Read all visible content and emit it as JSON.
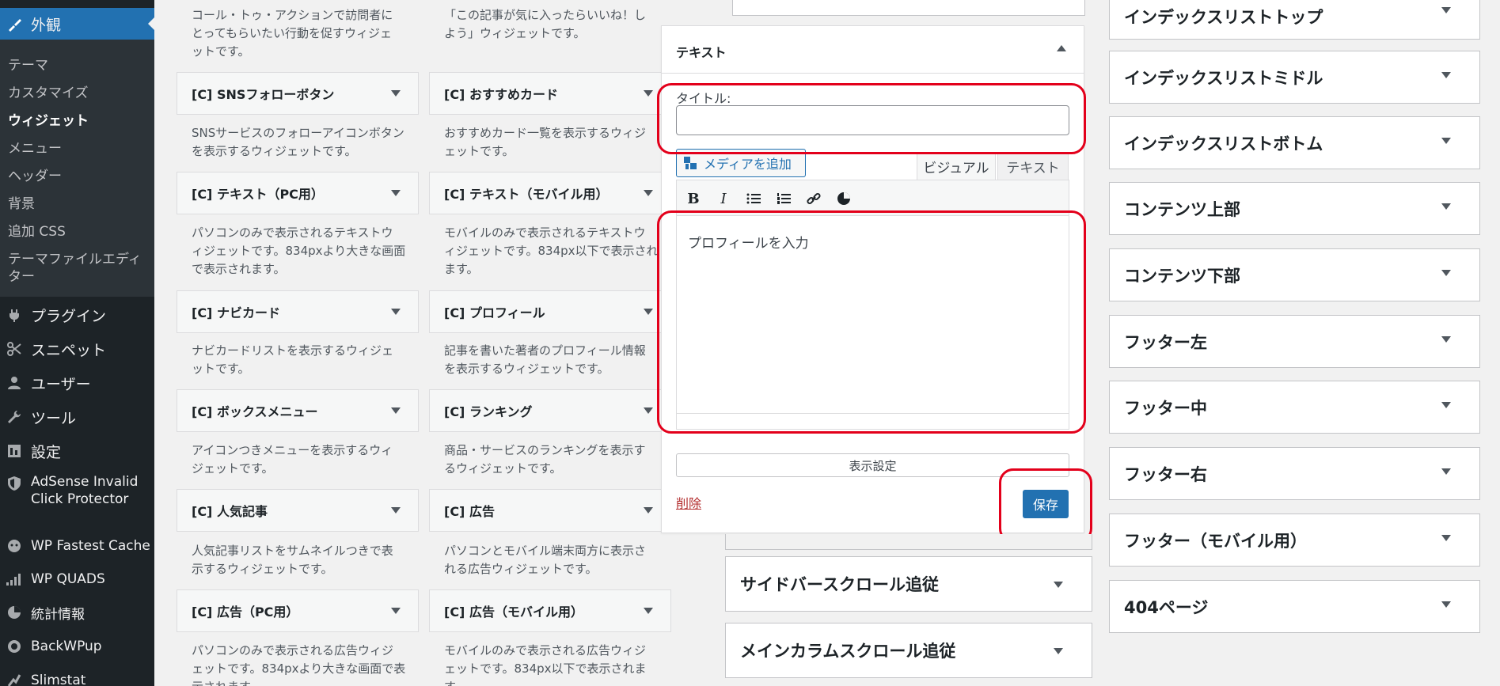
{
  "admin_menu": {
    "current": "外観",
    "submenu": [
      "テーマ",
      "カスタマイズ",
      "ウィジェット",
      "メニュー",
      "ヘッダー",
      "背景",
      "追加 CSS",
      "テーマファイルエディ",
      "ター"
    ],
    "items": [
      "プラグイン",
      "スニペット",
      "ユーザー",
      "ツール",
      "設定",
      "AdSense Invalid",
      "Click Protector",
      "WP Fastest Cache",
      "WP QUADS",
      "統計情報",
      "BackWPup",
      "Slimstat"
    ]
  },
  "widgets_left": [
    {
      "title": "",
      "desc": [
        "コール・トゥ・アクションで訪問者に",
        "とってもらいたい行動を促すウィジェ",
        "ットです。"
      ]
    },
    {
      "title": "[C] SNSフォローボタン",
      "desc": [
        "SNSサービスのフォローアイコンボタン",
        "を表示するウィジェットです。"
      ]
    },
    {
      "title": "[C] テキスト（PC用）",
      "desc": [
        "パソコンのみで表示されるテキストウ",
        "ィジェットです。834pxより大きな画面",
        "で表示されます。"
      ]
    },
    {
      "title": "[C] ナビカード",
      "desc": [
        "ナビカードリストを表示するウィジェ",
        "ットです。"
      ]
    },
    {
      "title": "[C] ボックスメニュー",
      "desc": [
        "アイコンつきメニューを表示するウィ",
        "ジェットです。"
      ]
    },
    {
      "title": "[C] 人気記事",
      "desc": [
        "人気記事リストをサムネイルつきで表",
        "示するウィジェットです。"
      ]
    },
    {
      "title": "[C] 広告（PC用）",
      "desc": [
        "パソコンのみで表示される広告ウィジ",
        "ェットです。834pxより大きな画面で表",
        "示されます。"
      ]
    }
  ],
  "widgets_right": [
    {
      "title": "",
      "desc": [
        "「この記事が気に入ったらいいね！し",
        "よう」ウィジェットです。"
      ]
    },
    {
      "title": "[C] おすすめカード",
      "desc": [
        "おすすめカード一覧を表示するウィジ",
        "ェットです。"
      ]
    },
    {
      "title": "[C] テキスト（モバイル用）",
      "desc": [
        "モバイルのみで表示されるテキストウ",
        "ィジェットです。834px以下で表示され",
        "ます。"
      ]
    },
    {
      "title": "[C] プロフィール",
      "desc": [
        "記事を書いた著者のプロフィール情報",
        "を表示するウィジェットです。"
      ]
    },
    {
      "title": "[C] ランキング",
      "desc": [
        "商品・サービスのランキングを表示す",
        "るウィジェットです。"
      ]
    },
    {
      "title": "[C] 広告",
      "desc": [
        "パソコンとモバイル端末両方に表示さ",
        "れる広告ウィジェットです。"
      ]
    },
    {
      "title": "[C] 広告（モバイル用）",
      "desc": [
        "モバイルのみで表示される広告ウィジ",
        "ェットです。834px以下で表示されま",
        "す。"
      ]
    }
  ],
  "text_widget": {
    "header": "テキスト",
    "title_label": "タイトル:",
    "title_value": "",
    "media_button": "メディアを追加",
    "tab_visual": "ビジュアル",
    "tab_text": "テキスト",
    "content": "プロフィールを入力",
    "display_settings": "表示設定",
    "delete": "削除",
    "save": "保存"
  },
  "middle_areas": [
    "サイドバースクロール追従",
    "メインカラムスクロール追従"
  ],
  "right_areas": [
    "インデックスリストトップ",
    "インデックスリストミドル",
    "インデックスリストボトム",
    "コンテンツ上部",
    "コンテンツ下部",
    "フッター左",
    "フッター中",
    "フッター右",
    "フッター（モバイル用）",
    "404ページ"
  ],
  "colors": {
    "highlight": "#e3001b",
    "primary": "#2271b1",
    "sidebar": "#1d2327"
  }
}
